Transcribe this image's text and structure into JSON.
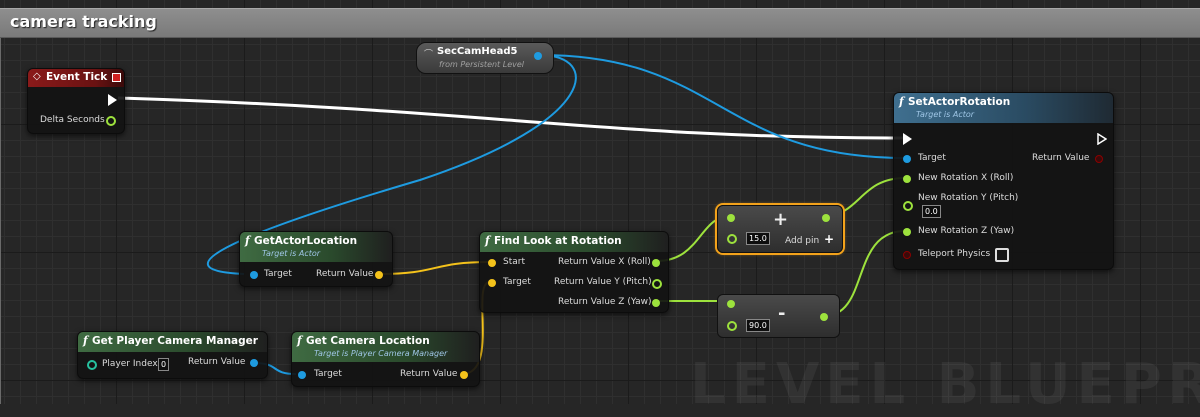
{
  "comment": {
    "title": "camera tracking"
  },
  "watermark": "LEVEL BLUEPRINT",
  "colors": {
    "object": "#1e9be0",
    "float": "#9de23d",
    "vector": "#f4c21b",
    "rotator": "#9fb6ff",
    "bool": "#8b0000",
    "int": "#26c2a0",
    "exec": "#ffffff"
  },
  "nodes": {
    "event_tick": {
      "title": "Event Tick",
      "pins": {
        "delta": "Delta Seconds"
      }
    },
    "sec_cam": {
      "title": "SecCamHead5",
      "sub": "from Persistent Level"
    },
    "set_actor_rotation": {
      "title": "SetActorRotation",
      "sub": "Target is Actor",
      "pins": {
        "target": "Target",
        "return_value": "Return Value",
        "new_x": "New Rotation X (Roll)",
        "new_y": "New Rotation Y (Pitch)",
        "new_y_value": "0.0",
        "new_z": "New Rotation Z (Yaw)",
        "teleport": "Teleport Physics"
      }
    },
    "get_actor_location": {
      "title": "GetActorLocation",
      "sub": "Target is Actor",
      "pins": {
        "target": "Target",
        "return_value": "Return Value"
      }
    },
    "find_look_at": {
      "title": "Find Look at Rotation",
      "pins": {
        "start": "Start",
        "target": "Target",
        "rx": "Return Value X (Roll)",
        "ry": "Return Value Y (Pitch)",
        "rz": "Return Value Z (Yaw)"
      }
    },
    "add_node": {
      "value": "15.0",
      "add_pin": "Add pin"
    },
    "sub_node": {
      "value": "90.0"
    },
    "get_player_cam_mgr": {
      "title": "Get Player Camera Manager",
      "pins": {
        "player_index": "Player Index",
        "player_index_value": "0",
        "return_value": "Return Value"
      }
    },
    "get_cam_location": {
      "title": "Get Camera Location",
      "sub": "Target is Player Camera Manager",
      "pins": {
        "target": "Target",
        "return_value": "Return Value"
      }
    }
  }
}
